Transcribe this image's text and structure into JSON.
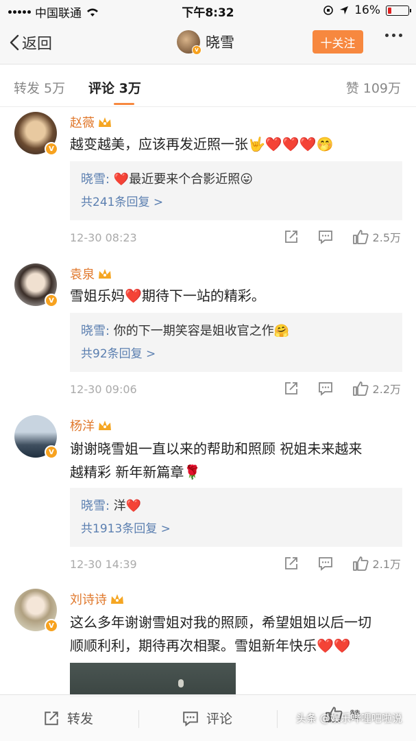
{
  "status_bar": {
    "carrier": "中国联通",
    "time": "下午8:32",
    "battery": "16%"
  },
  "nav": {
    "back_label": "返回",
    "title": "晓雪",
    "follow_label": "十关注"
  },
  "tabs": {
    "repost": "转发 5万",
    "comment": "评论 3万",
    "like": "赞 109万"
  },
  "comments": [
    {
      "name": "赵薇",
      "text": "越变越美，应该再发近照一张🤟❤️❤️❤️🤭",
      "reply_author": "晓雪:",
      "reply_text": " ❤️最近要来个合影近照😛",
      "reply_count": "共241条回复 >",
      "time": "12-30 08:23",
      "likes": "2.5万"
    },
    {
      "name": "袁泉",
      "text": "雪姐乐妈❤️期待下一站的精彩。",
      "reply_author": "晓雪:",
      "reply_text": " 你的下一期笑容是姐收官之作🤗",
      "reply_count": "共92条回复 >",
      "time": "12-30 09:06",
      "likes": "2.2万"
    },
    {
      "name": "杨洋",
      "text_line1": "谢谢晓雪姐一直以来的帮助和照顾  祝姐未来越来",
      "text_line2": "越精彩  新年新篇章🌹",
      "reply_author": "晓雪:",
      "reply_text": " 洋❤️",
      "reply_count": "共1913条回复 >",
      "time": "12-30 14:39",
      "likes": "2.1万"
    },
    {
      "name": "刘诗诗",
      "text_line1": "这么多年谢谢雪姐对我的照顾，希望姐姐以后一切",
      "text_line2": "顺顺利利，期待再次相聚。雪姐新年快乐❤️❤️"
    }
  ],
  "bottom_bar": {
    "repost": "转发",
    "comment": "评论",
    "like": "赞"
  },
  "watermark": "头条 @娱乐哔哩吧啦说",
  "colors": {
    "accent": "#f7883f",
    "username": "#e0782c",
    "link": "#5b7fb0"
  }
}
